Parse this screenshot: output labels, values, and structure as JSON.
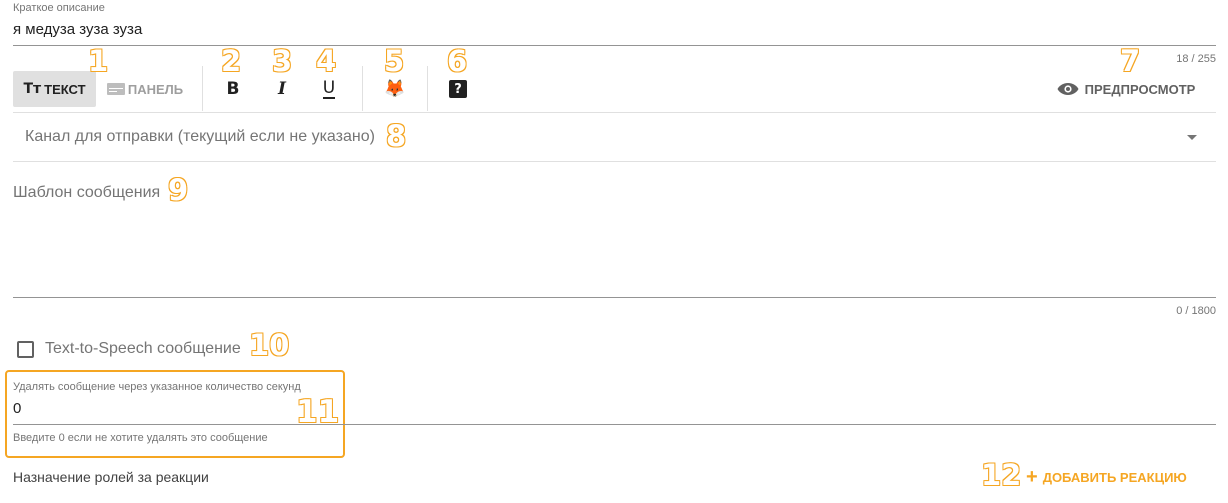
{
  "short_description": {
    "label": "Краткое описание",
    "value": "я медуза зуза зуза",
    "counter": "18 / 255"
  },
  "toolbar": {
    "text_tab": "ТЕКСТ",
    "text_tab_icon": "Tт",
    "panel_tab": "ПАНЕЛЬ",
    "bold_label": "B",
    "italic_label": "I",
    "underline_label": "U",
    "emoji": "🦊",
    "help_label": "?",
    "preview_label": "ПРЕДПРОСМОТР"
  },
  "channel_select": {
    "placeholder": "Канал для отправки (текущий если не указано)"
  },
  "message_template": {
    "placeholder": "Шаблон сообщения",
    "counter": "0 / 1800"
  },
  "tts": {
    "label": "Text-to-Speech сообщение",
    "checked": false
  },
  "delete_after": {
    "label": "Удалять сообщение через указанное количество секунд",
    "value": "0",
    "hint": "Введите 0 если не хотите удалять это сообщение"
  },
  "roles": {
    "heading": "Назначение ролей за реакции",
    "add_button": "ДОБАВИТЬ РЕАКЦИЮ"
  },
  "annotations": [
    "1",
    "2",
    "3",
    "4",
    "5",
    "6",
    "7",
    "8",
    "9",
    "10",
    "11",
    "12"
  ],
  "colors": {
    "accent": "#f5a623",
    "active_tab_bg": "#e0e0e0",
    "muted_text": "#757575"
  }
}
